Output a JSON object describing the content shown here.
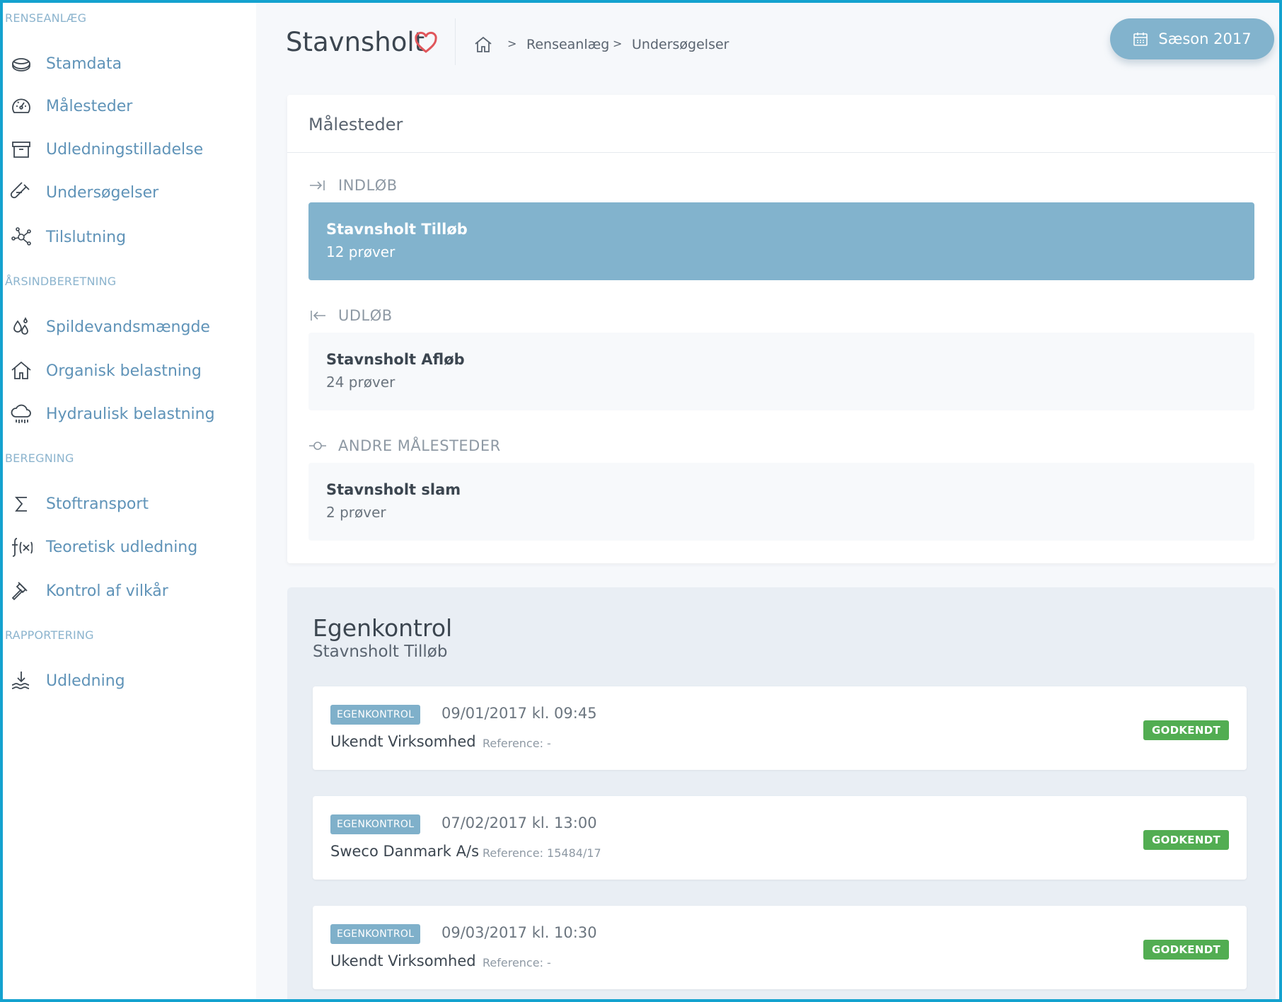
{
  "sidebar": {
    "sections": [
      {
        "title": "RENSEANLÆG",
        "items": [
          {
            "label": "Stamdata",
            "icon": "database-icon"
          },
          {
            "label": "Målesteder",
            "icon": "gauge-icon"
          },
          {
            "label": "Udledningstilladelse",
            "icon": "archive-icon"
          },
          {
            "label": "Undersøgelser",
            "icon": "test-tube-icon"
          },
          {
            "label": "Tilslutning",
            "icon": "network-icon"
          }
        ]
      },
      {
        "title": "ÅRSINDBERETNING",
        "items": [
          {
            "label": "Spildevandsmængde",
            "icon": "drops-icon"
          },
          {
            "label": "Organisk belastning",
            "icon": "home-icon"
          },
          {
            "label": "Hydraulisk belastning",
            "icon": "cloud-rain-icon"
          }
        ]
      },
      {
        "title": "BEREGNING",
        "items": [
          {
            "label": "Stoftransport",
            "icon": "sigma-icon"
          },
          {
            "label": "Teoretisk udledning",
            "icon": "function-icon"
          },
          {
            "label": "Kontrol af vilkår",
            "icon": "gavel-icon"
          }
        ]
      },
      {
        "title": "RAPPORTERING",
        "items": [
          {
            "label": "Udledning",
            "icon": "discharge-icon"
          }
        ]
      }
    ]
  },
  "header": {
    "title": "Stavnsholt",
    "breadcrumb": {
      "separator": ">",
      "items": [
        "Renseanlæg",
        "Undersøgelser"
      ]
    },
    "season_button": "Sæson 2017"
  },
  "malesteder": {
    "title": "Målesteder",
    "groups": [
      {
        "label": "INDLØB",
        "icon": "arrow-in-icon",
        "site": {
          "name": "Stavnsholt Tilløb",
          "count": "12 prøver",
          "active": true
        }
      },
      {
        "label": "UDLØB",
        "icon": "arrow-out-icon",
        "site": {
          "name": "Stavnsholt Afløb",
          "count": "24 prøver",
          "active": false
        }
      },
      {
        "label": "ANDRE MÅLESTEDER",
        "icon": "node-icon",
        "site": {
          "name": "Stavnsholt slam",
          "count": "2 prøver",
          "active": false
        }
      }
    ]
  },
  "egenkontrol": {
    "title": "Egenkontrol",
    "subtitle": "Stavnsholt Tilløb",
    "entries": [
      {
        "tag": "EGENKONTROL",
        "date": "09/01/2017 kl. 09:45",
        "company": "Ukendt Virksomhed",
        "reference": "Reference: -",
        "status": "GODKENDT"
      },
      {
        "tag": "EGENKONTROL",
        "date": "07/02/2017 kl. 13:00",
        "company": "Sweco Danmark A/s",
        "reference": "Reference: 15484/17",
        "status": "GODKENDT"
      },
      {
        "tag": "EGENKONTROL",
        "date": "09/03/2017 kl. 10:30",
        "company": "Ukendt Virksomhed",
        "reference": "Reference: -",
        "status": "GODKENDT"
      }
    ]
  },
  "colors": {
    "frame": "#14a2cf",
    "accent": "#82b3cd",
    "nav_text": "#5f93b8",
    "section_title": "#8cb4ce",
    "status_ok": "#52ad52",
    "heart": "#e0565b"
  }
}
